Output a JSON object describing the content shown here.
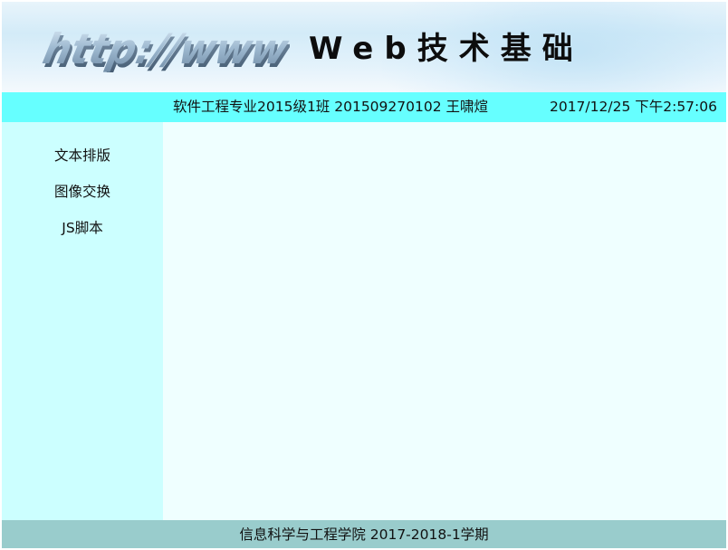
{
  "header": {
    "logo_text": "http://www",
    "title": "Web技术基础"
  },
  "infobar": {
    "student_info": "软件工程专业2015级1班 201509270102 王啸煊",
    "datetime": "2017/12/25 下午2:57:06"
  },
  "sidebar": {
    "items": [
      {
        "label": "文本排版"
      },
      {
        "label": "图像交换"
      },
      {
        "label": "JS脚本"
      }
    ]
  },
  "footer": {
    "text": "信息科学与工程学院 2017-2018-1学期"
  },
  "colors": {
    "infobar_bg": "#66ffff",
    "sidebar_bg": "#ccffff",
    "content_bg": "#efffff",
    "footer_bg": "#99cccc"
  }
}
